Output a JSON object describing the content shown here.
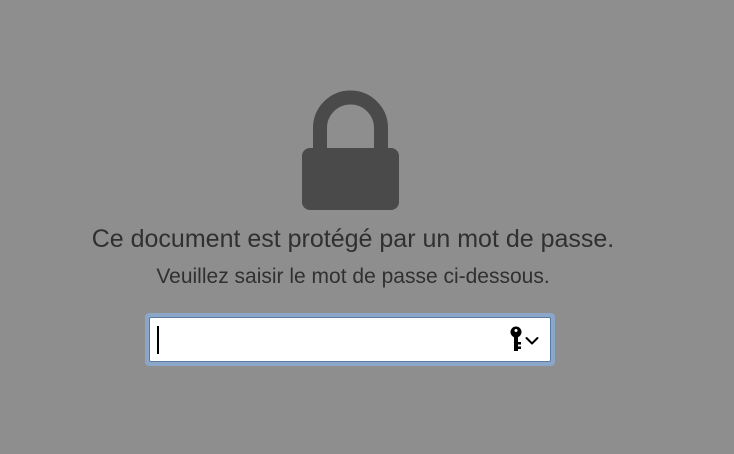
{
  "prompt": {
    "title": "Ce document est protégé par un mot de passe.",
    "subtitle": "Veuillez saisir le mot de passe ci-dessous."
  },
  "password_field": {
    "value": "",
    "placeholder": ""
  },
  "icons": {
    "lock": "lock-icon",
    "key": "key-icon",
    "chevron": "chevron-down-icon"
  },
  "colors": {
    "background": "#8e8e8e",
    "lock": "#4a4a4a",
    "text": "#303030",
    "focus_ring": "#8aa6c9"
  }
}
